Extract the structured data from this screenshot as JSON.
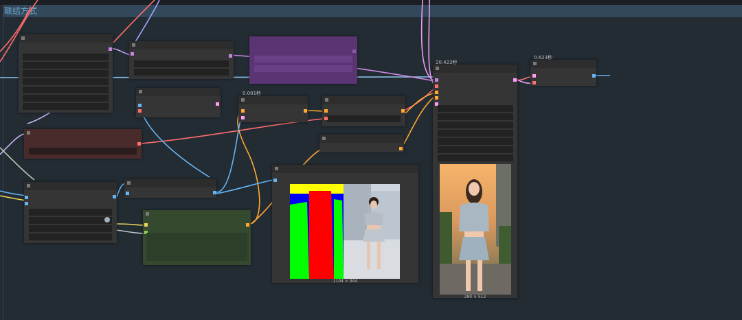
{
  "group": {
    "title": "联结方式"
  },
  "timings": {
    "sampler": "0.001秒",
    "vae_decode": "20.423秒",
    "output": "0.623秒"
  },
  "images": {
    "mask_size": "1104 × 944",
    "result_size": "280 × 512"
  },
  "colors": {
    "canvas_bg": "#232b33",
    "node_bg": "#353535",
    "group_header": "#33495b",
    "purple_node": "#5b3473",
    "red_node": "#4a2b2b",
    "green_node": "#35492f",
    "link_model": "#a0c8ec",
    "link_clip": "#e8d55a",
    "link_vae": "#ff6e6e",
    "link_latent": "#ff9cf9",
    "link_conditioning": "#ffa931",
    "link_image": "#64b5f6",
    "link_mask": "#8fd14f"
  }
}
